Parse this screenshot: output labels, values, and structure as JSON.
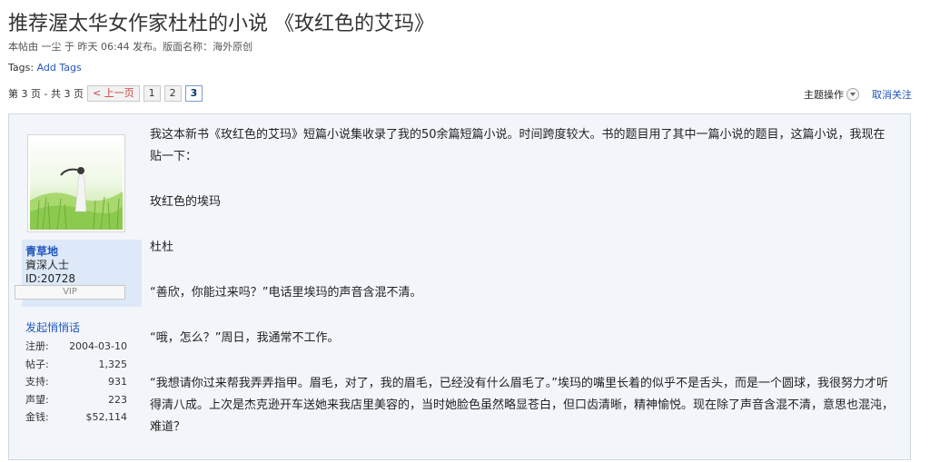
{
  "thread": {
    "title": "推荐渥太华女作家杜杜的小说 《玫红色的艾玛》",
    "meta_text": "本帖由 一尘 于 昨天 06:44 发布。版面名称：海外原创",
    "tags_label": "Tags:",
    "add_tags": "Add Tags"
  },
  "pager": {
    "info": "第 3 页 - 共 3 页",
    "prev": "< 上一页",
    "pages": [
      "1",
      "2",
      "3"
    ],
    "current": "3"
  },
  "actions": {
    "thread_ops": "主题操作",
    "unfollow": "取消关注"
  },
  "author": {
    "name": "青草地",
    "rank": "資深人士",
    "id_text": "ID:20728",
    "vip": "VIP",
    "pm": "发起悄悄话",
    "stats": [
      {
        "label": "注册:",
        "value": "2004-03-10"
      },
      {
        "label": "帖子:",
        "value": "1,325"
      },
      {
        "label": "支持:",
        "value": "931"
      },
      {
        "label": "声望:",
        "value": "223"
      },
      {
        "label": "金钱:",
        "value": "$52,114"
      }
    ]
  },
  "post": {
    "paragraphs": [
      "我这本新书《玫红色的艾玛》短篇小说集收录了我的50余篇短篇小说。时间跨度较大。书的题目用了其中一篇小说的题目，这篇小说，我现在贴一下：",
      "玫红色的埃玛",
      "杜杜",
      "“善欣，你能过来吗？”电话里埃玛的声音含混不清。",
      "“哦，怎么？”周日，我通常不工作。",
      "“我想请你过来帮我弄弄指甲。眉毛，对了，我的眉毛，已经没有什么眉毛了。”埃玛的嘴里长着的似乎不是舌头，而是一个圆球，我很努力才听得清八成。上次是杰克逊开车送她来我店里美容的，当时她脸色虽然略显苍白，但口齿清晰，精神愉悦。现在除了声音含混不清，意思也混沌，难道？"
    ]
  },
  "colors": {
    "link": "#2255bb",
    "post_bg": "#f2f6fa",
    "userblock_bg": "#dde9f8"
  }
}
